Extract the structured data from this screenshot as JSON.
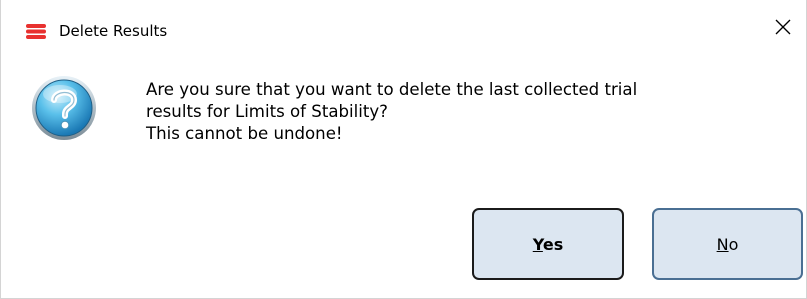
{
  "window": {
    "title": "Delete Results",
    "app_icon": "stack-icon",
    "close_icon": "close-icon"
  },
  "dialog": {
    "icon": "question-icon",
    "message_lines": [
      "Are you sure that you want to delete the last collected trial",
      "results for Limits of Stability?",
      "This cannot be undone!"
    ]
  },
  "buttons": {
    "yes_label": "Yes",
    "no_label": "No"
  },
  "colors": {
    "app_icon_red": "#e8312f",
    "button_face": "#dce6f1",
    "default_button_border": "#1b1b1b",
    "button_border": "#4a6f93",
    "icon_blue": "#2f9fd6"
  }
}
